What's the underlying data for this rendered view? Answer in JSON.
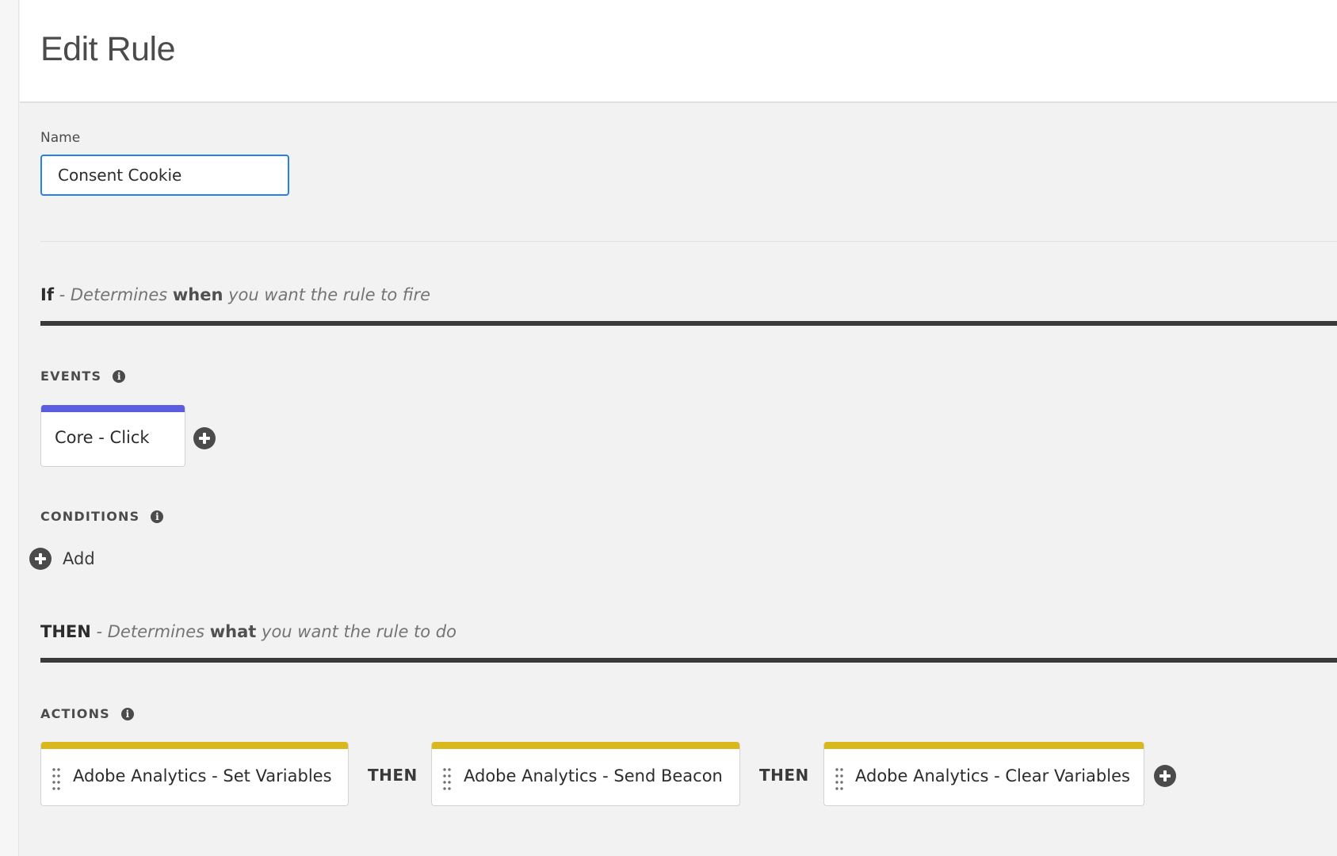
{
  "header": {
    "title": "Edit Rule"
  },
  "name_field": {
    "label": "Name",
    "value": "Consent Cookie"
  },
  "if_section": {
    "keyword": "If",
    "desc_prefix": " - Determines ",
    "desc_bold": "when",
    "desc_suffix": " you want the rule to fire"
  },
  "events": {
    "label": "EVENTS",
    "items": [
      {
        "label": "Core - Click",
        "color": "#5c5ce0"
      }
    ]
  },
  "conditions": {
    "label": "CONDITIONS",
    "add_label": "Add"
  },
  "then_section": {
    "keyword": "THEN",
    "desc_prefix": " - Determines ",
    "desc_bold": "what",
    "desc_suffix": " you want the rule to do"
  },
  "actions": {
    "label": "ACTIONS",
    "connector": "THEN",
    "items": [
      {
        "label": "Adobe Analytics - Set Variables",
        "color": "#d9b81c"
      },
      {
        "label": "Adobe Analytics - Send Beacon",
        "color": "#d9b81c"
      },
      {
        "label": "Adobe Analytics - Clear Variables",
        "color": "#d9b81c"
      }
    ]
  },
  "icons": {
    "info": "info-icon",
    "add": "plus-circle-icon",
    "drag": "drag-handle-icon"
  },
  "colors": {
    "input_focus": "#2680eb",
    "event_accent": "#5c5ce0",
    "action_accent": "#d9b81c",
    "section_rule": "#3a3a3a"
  }
}
